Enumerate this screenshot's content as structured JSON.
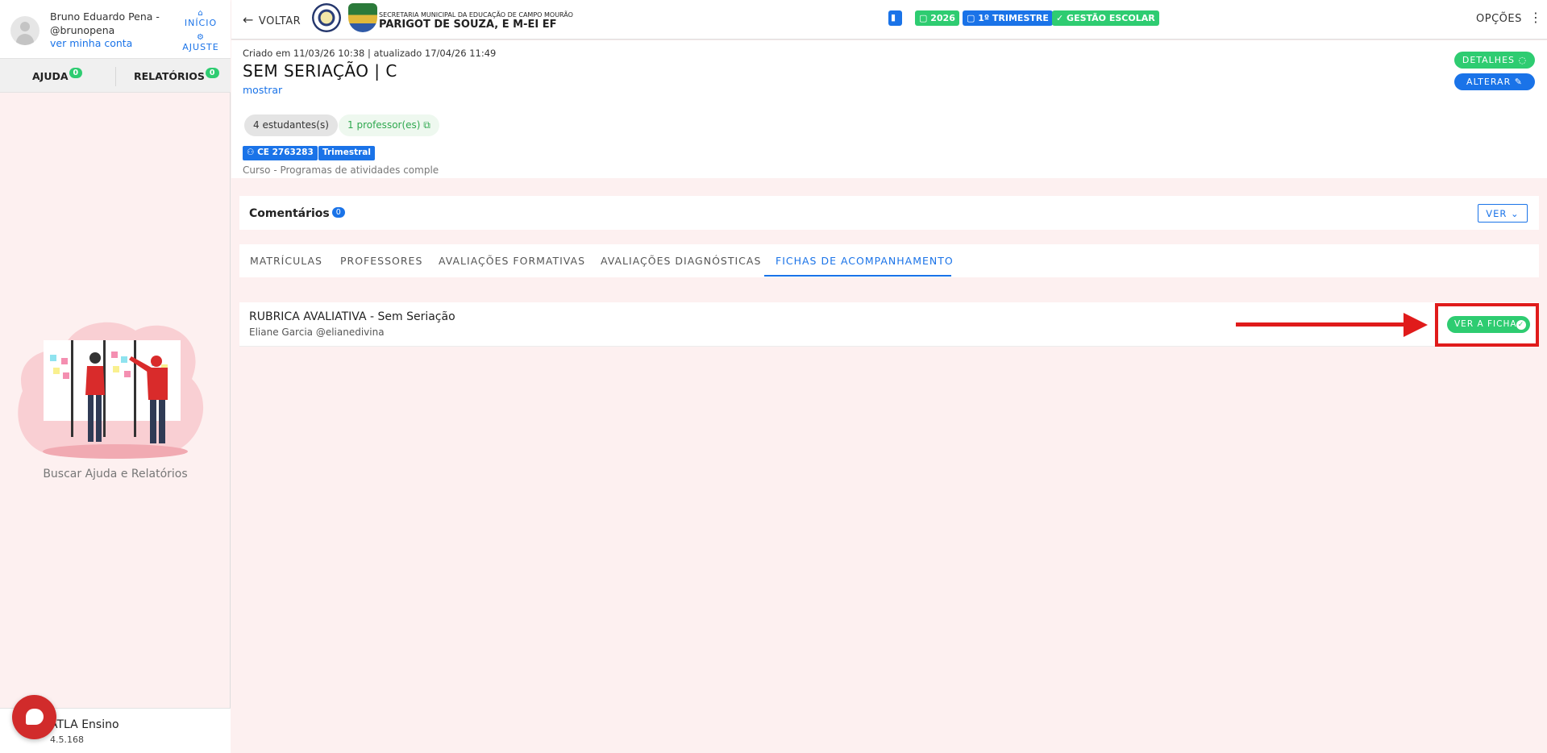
{
  "user": {
    "name": "Bruno Eduardo Pena - @brunopena",
    "account_link": "ver minha conta",
    "inicio_label": "INÍCIO",
    "ajuste_label": "AJUSTE"
  },
  "sidebar": {
    "tabs": [
      {
        "label": "AJUDA",
        "count": "0"
      },
      {
        "label": "RELATÓRIOS",
        "count": "0"
      }
    ],
    "help_text": "Buscar Ajuda e Relatórios",
    "app_name": "ATLA Ensino",
    "app_version": "4.5.168"
  },
  "topbar": {
    "back_label": "VOLTAR",
    "school_subtitle": "SECRETARIA MUNICIPAL DA EDUCAÇÃO DE CAMPO MOURÃO",
    "school_name": "PARIGOT DE SOUZA, E M-EI EF",
    "chips": {
      "year": "2026",
      "term": "1º TRIMESTRE",
      "management": "GESTÃO ESCOLAR"
    },
    "options_label": "OPÇÕES"
  },
  "header": {
    "meta": "Criado em 11/03/26 10:38 | atualizado 17/04/26 11:49",
    "title": "SEM SERIAÇÃO | C",
    "show_link": "mostrar",
    "students_pill": "4 estudantes(s)",
    "professors_pill": "1 professor(es)",
    "ce_badge": "CE 2763283",
    "period_badge": "Trimestral",
    "course": "Curso - Programas de atividades comple",
    "details_button": "DETALHES",
    "edit_button": "ALTERAR"
  },
  "comments": {
    "title": "Comentários",
    "count": "0",
    "ver_button": "VER"
  },
  "tabs": [
    {
      "label": "MATRÍCULAS"
    },
    {
      "label": "PROFESSORES"
    },
    {
      "label": "AVALIAÇÕES FORMATIVAS"
    },
    {
      "label": "AVALIAÇÕES DIAGNÓSTICAS"
    },
    {
      "label": "FICHAS DE ACOMPANHAMENTO"
    }
  ],
  "active_tab": "FICHAS DE ACOMPANHAMENTO",
  "ficha": {
    "title": "RUBRICA AVALIATIVA - Sem Seriação",
    "author": "Eliane Garcia @elianedivina",
    "button": "VER A FICHA"
  },
  "colors": {
    "accent_blue": "#1a73e8",
    "accent_green": "#2ecc71",
    "annotation_red": "#e01b1b",
    "background_pink": "#fdf0f0"
  }
}
